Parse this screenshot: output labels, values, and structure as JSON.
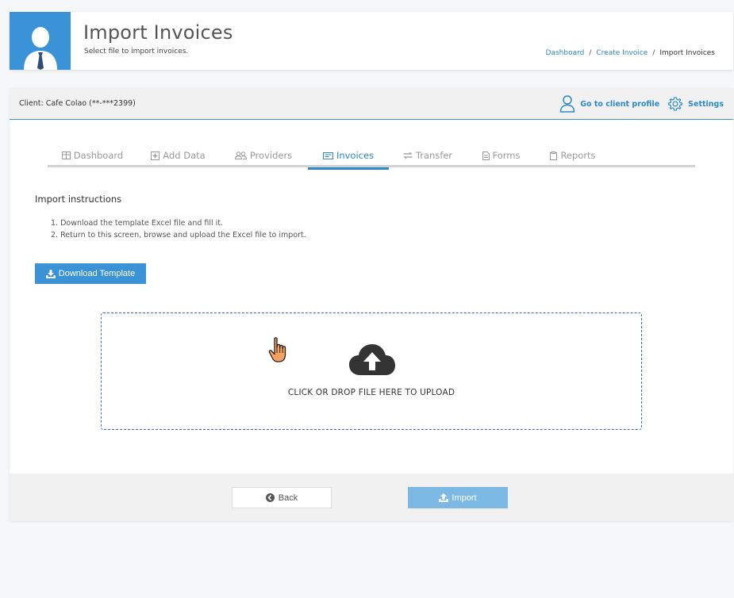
{
  "header": {
    "title": "Import Invoices",
    "subtitle": "Select file to import invoices.",
    "avatar_icon": "user-tie-icon",
    "breadcrumb": [
      {
        "label": "Dashboard",
        "link": true
      },
      {
        "label": "Create Invoice",
        "link": true
      },
      {
        "label": "Import Invoices",
        "link": false
      }
    ],
    "breadcrumb_separator": "/"
  },
  "client_bar": {
    "client_label": "Client: Cafe Colao (**-***2399)",
    "profile_link": "Go to client profile",
    "settings_link": "Settings"
  },
  "tabs": [
    {
      "label": "Dashboard",
      "icon": "table-icon",
      "active": false
    },
    {
      "label": "Add Data",
      "icon": "plus-square-icon",
      "active": false
    },
    {
      "label": "Providers",
      "icon": "users-icon",
      "active": false
    },
    {
      "label": "Invoices",
      "icon": "invoice-icon",
      "active": true
    },
    {
      "label": "Transfer",
      "icon": "exchange-icon",
      "active": false
    },
    {
      "label": "Forms",
      "icon": "file-icon",
      "active": false
    },
    {
      "label": "Reports",
      "icon": "clipboard-icon",
      "active": false
    }
  ],
  "instructions": {
    "title": "Import instructions",
    "steps": [
      "1. Download the template Excel file and fill it.",
      "2. Return to this screen, browse and upload the Excel file to import."
    ]
  },
  "download_button": "Download Template",
  "dropzone": {
    "text": "CLICK OR DROP FILE HERE TO UPLOAD",
    "icon": "cloud-upload-icon"
  },
  "footer": {
    "back_label": "Back",
    "import_label": "Import"
  },
  "colors": {
    "accent": "#3a93d6",
    "link": "#2d8ac7",
    "import_disabled": "#7cb8e4"
  }
}
